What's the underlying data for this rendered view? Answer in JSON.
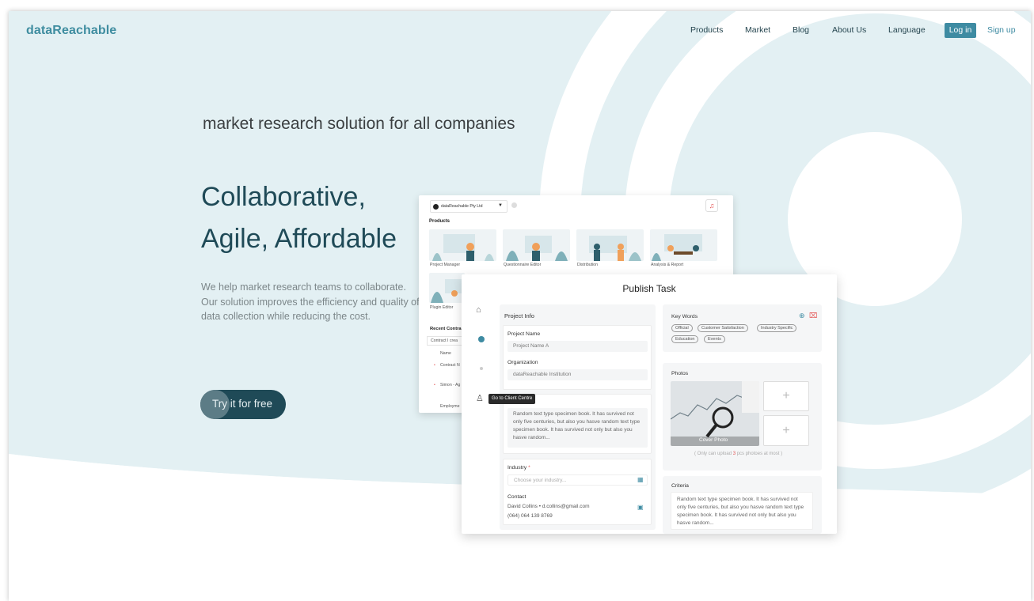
{
  "brand": {
    "name": "dataReachable"
  },
  "nav": {
    "items": [
      "Products",
      "Market",
      "Blog",
      "About Us",
      "Language"
    ],
    "login": "Log in",
    "signup": "Sign up"
  },
  "hero": {
    "tagline": "market research solution for all companies",
    "headline_line1": "Collaborative,",
    "headline_line2": "Agile, Affordable",
    "desc_line1": "We help market research teams to collaborate.",
    "desc_line2": "Our solution improves the efficiency and quality of",
    "desc_line3": "data collection while reducing the cost.",
    "cta": "Try it for free"
  },
  "back_card": {
    "org": "dataReachable Pty Ltd",
    "products_title": "Products",
    "products": [
      "Project Manager",
      "Questionnaire Editor",
      "Distribution",
      "Analysis & Report",
      "Plugin Editor"
    ],
    "recent_title": "Recent Contra",
    "row_contract": "Contract I crea",
    "col_name": "Name",
    "items": [
      "Contract N",
      "Simon - Ag",
      "Employme"
    ]
  },
  "tooltip": "Go to Client Centre",
  "publish": {
    "title": "Publish Task",
    "project_info": "Project Info",
    "project_name_label": "Project Name",
    "project_name_placeholder": "Project Name A",
    "organization_label": "Organization",
    "organization_value": "dataReachable Institution",
    "description_text": "Random text  type specimen book. It has survived not only five centuries, but also you hasve random text  type specimen book. It has survived not only but also you hasve random...",
    "industry_label": "Industry",
    "industry_required": "*",
    "industry_placeholder": "Choose your industry...",
    "contact_label": "Contact",
    "contact_line1": "David Collins  •  d.collins@gmail.com",
    "contact_line2": "(064) 064 139 8769",
    "keywords_label": "Key Words",
    "keywords": [
      "Official",
      "Customer Satisfaction",
      "Industry Specific",
      "Education",
      "Events"
    ],
    "photos_label": "Photos",
    "cover_label": "Cover Photo",
    "upload_note_pre": "( Only can upload ",
    "upload_note_num": "3",
    "upload_note_post": " pcs photoes at most )",
    "criteria_label": "Criteria",
    "criteria_text": "Random text  type specimen book. It has survived not only five centuries, but also you hasve random text  type specimen book. It has survived not only but also you hasve random..."
  },
  "colors": {
    "brand": "#3f8da0",
    "hero_bg": "#e3f0f3",
    "dark": "#1f4a57",
    "button": "#3e8ba2"
  }
}
